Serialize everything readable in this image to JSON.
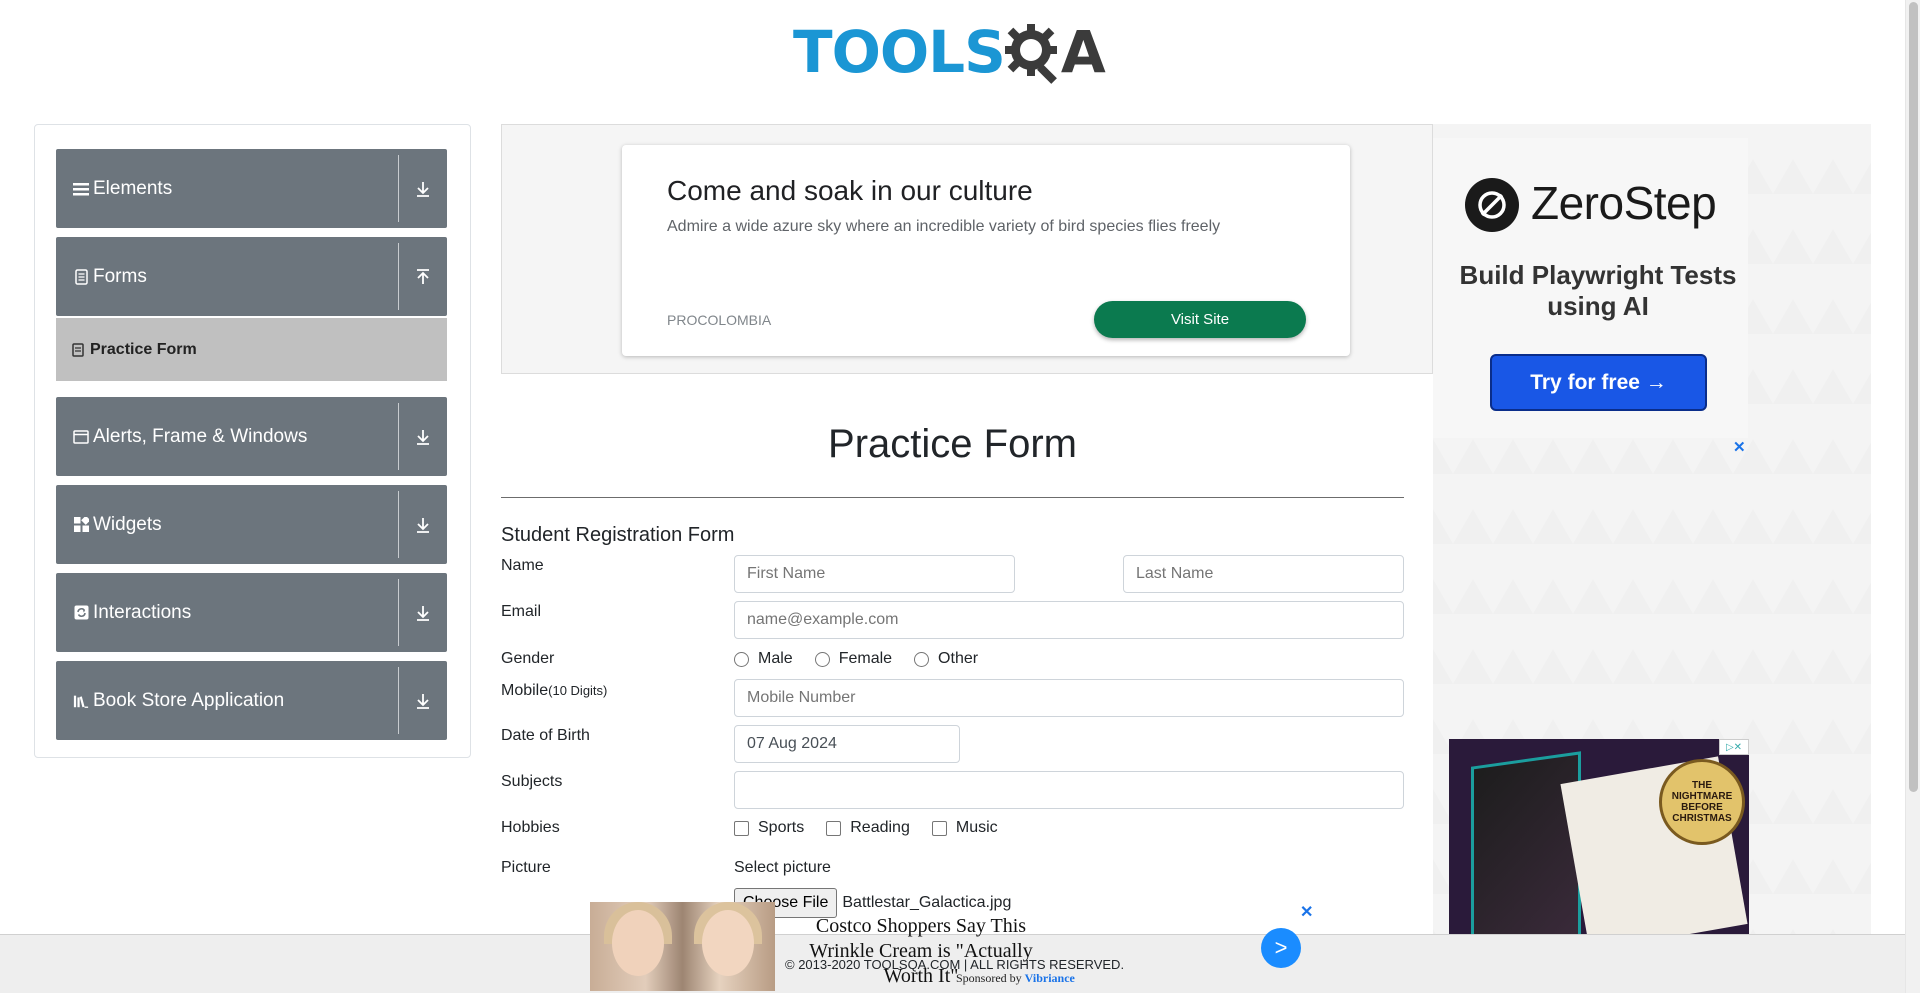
{
  "header": {
    "logo_tools": "TOOLS",
    "logo_qa": "A"
  },
  "sidebar": {
    "groups": [
      {
        "label": "Elements",
        "icon": "hamburger-icon"
      },
      {
        "label": "Forms",
        "icon": "document-icon"
      },
      {
        "label": "Alerts, Frame & Windows",
        "icon": "window-icon"
      },
      {
        "label": "Widgets",
        "icon": "grid-icon"
      },
      {
        "label": "Interactions",
        "icon": "refresh-icon"
      },
      {
        "label": "Book Store Application",
        "icon": "books-icon"
      }
    ],
    "active_item": {
      "label": "Practice Form",
      "icon": "form-icon"
    }
  },
  "ad_banner": {
    "title": "Come and soak in our culture",
    "description": "Admire a wide azure sky where an incredible variety of bird species flies freely",
    "brand": "PROCOLOMBIA",
    "button": "Visit Site"
  },
  "right_ad": {
    "brand": "ZeroStep",
    "headline": "Build Playwright Tests using AI",
    "button": "Try for free →",
    "close": "✕",
    "badge_text": "THE NIGHTMARE BEFORE CHRISTMAS"
  },
  "form": {
    "page_title": "Practice Form",
    "subtitle": "Student Registration Form",
    "name_label": "Name",
    "first_name_placeholder": "First Name",
    "last_name_placeholder": "Last Name",
    "email_label": "Email",
    "email_placeholder": "name@example.com",
    "gender_label": "Gender",
    "gender_options": [
      "Male",
      "Female",
      "Other"
    ],
    "mobile_label": "Mobile",
    "mobile_hint": "(10 Digits)",
    "mobile_placeholder": "Mobile Number",
    "dob_label": "Date of Birth",
    "dob_value": "07 Aug 2024",
    "subjects_label": "Subjects",
    "hobbies_label": "Hobbies",
    "hobbies_options": [
      "Sports",
      "Reading",
      "Music"
    ],
    "picture_label": "Picture",
    "picture_select_label": "Select picture",
    "choose_file_label": "Choose File",
    "file_name": "Battlestar_Galactica.jpg"
  },
  "footer": {
    "text": "© 2013-2020 TOOLSQA.COM | ALL RIGHTS RESERVED."
  },
  "native_ad": {
    "title": "Costco Shoppers Say This Wrinkle Cream is \"Actually Worth It\"",
    "sponsor_prefix": "Sponsored by",
    "sponsor_name": "Vibriance",
    "go": ">",
    "close": "✕"
  }
}
